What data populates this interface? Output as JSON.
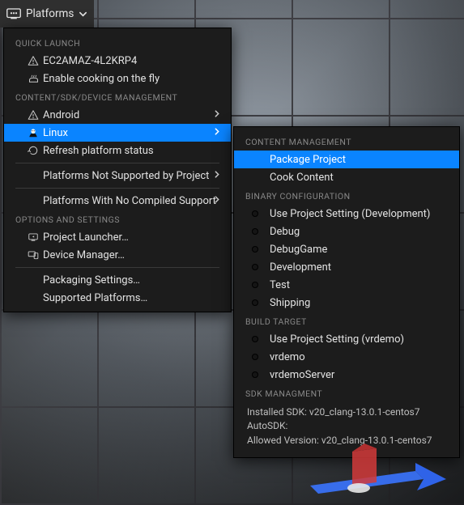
{
  "topbar": {
    "platforms_label": "Platforms"
  },
  "left_menu": {
    "sections": {
      "quick_launch": "QUICK LAUNCH",
      "content_mgmt": "CONTENT/SDK/DEVICE MANAGEMENT",
      "options": "OPTIONS AND SETTINGS"
    },
    "items": {
      "ec2": "EC2AMAZ-4L2KRP4",
      "cook_fly": "Enable cooking on the fly",
      "android": "Android",
      "linux": "Linux",
      "refresh": "Refresh platform status",
      "not_supported": "Platforms Not Supported by Project",
      "no_compiled": "Platforms With No Compiled Support",
      "project_launcher": "Project Launcher…",
      "device_manager": "Device Manager…",
      "packaging_settings": "Packaging Settings…",
      "supported_platforms": "Supported Platforms…"
    }
  },
  "right_menu": {
    "sections": {
      "content": "CONTENT MANAGEMENT",
      "binary": "BINARY CONFIGURATION",
      "build_target": "BUILD TARGET",
      "sdk": "SDK MANAGMENT"
    },
    "content": {
      "package": "Package Project",
      "cook": "Cook Content"
    },
    "binary": {
      "use_dev": "Use Project Setting (Development)",
      "debug": "Debug",
      "debug_game": "DebugGame",
      "development": "Development",
      "test": "Test",
      "shipping": "Shipping"
    },
    "build_target": {
      "use_vrdemo": "Use Project Setting (vrdemo)",
      "vrdemo": "vrdemo",
      "vrdemo_server": "vrdemoServer"
    },
    "sdk": {
      "installed": "Installed SDK: v20_clang-13.0.1-centos7",
      "auto": "AutoSDK:",
      "allowed": "Allowed Version: v20_clang-13.0.1-centos7"
    }
  }
}
